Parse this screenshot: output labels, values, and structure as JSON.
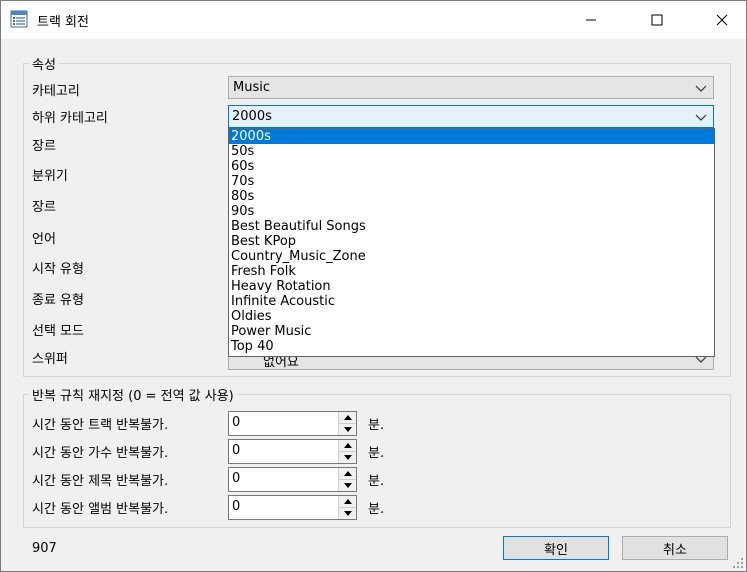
{
  "window": {
    "title": "트랙 회전",
    "icon": "list-window-icon"
  },
  "properties": {
    "group_label": "속성",
    "labels": [
      "카테고리",
      "하위 카테고리",
      "장르",
      "분위기",
      "장르",
      "언어",
      "시작 유형",
      "종료 유형",
      "선택 모드",
      "스위퍼"
    ],
    "category_value": "Music",
    "subcategory_value": "2000s",
    "sweeper_value": "없어요",
    "subcategory_options": [
      "2000s",
      "50s",
      "60s",
      "70s",
      "80s",
      "90s",
      "Best Beautiful Songs",
      "Best KPop",
      "Country_Music_Zone",
      "Fresh Folk",
      "Heavy Rotation",
      "Infinite Acoustic",
      "Oldies",
      "Power Music",
      "Top 40"
    ],
    "selected_option_index": 0
  },
  "repeat": {
    "group_label": "반복 규칙 재지정 (0 = 전역 값 사용)",
    "rows": [
      {
        "label": "시간 동안 트랙 반복불가.",
        "value": "0",
        "unit": "분."
      },
      {
        "label": "시간 동안 가수 반복불가.",
        "value": "0",
        "unit": "분."
      },
      {
        "label": "시간 동안 제목 반복불가.",
        "value": "0",
        "unit": "분."
      },
      {
        "label": "시간 동안 앨범 반복불가.",
        "value": "0",
        "unit": "분."
      }
    ]
  },
  "footer": {
    "count": "907",
    "ok_label": "확인",
    "cancel_label": "취소"
  },
  "colors": {
    "accent": "#0078d7",
    "background": "#f0f0f0"
  }
}
